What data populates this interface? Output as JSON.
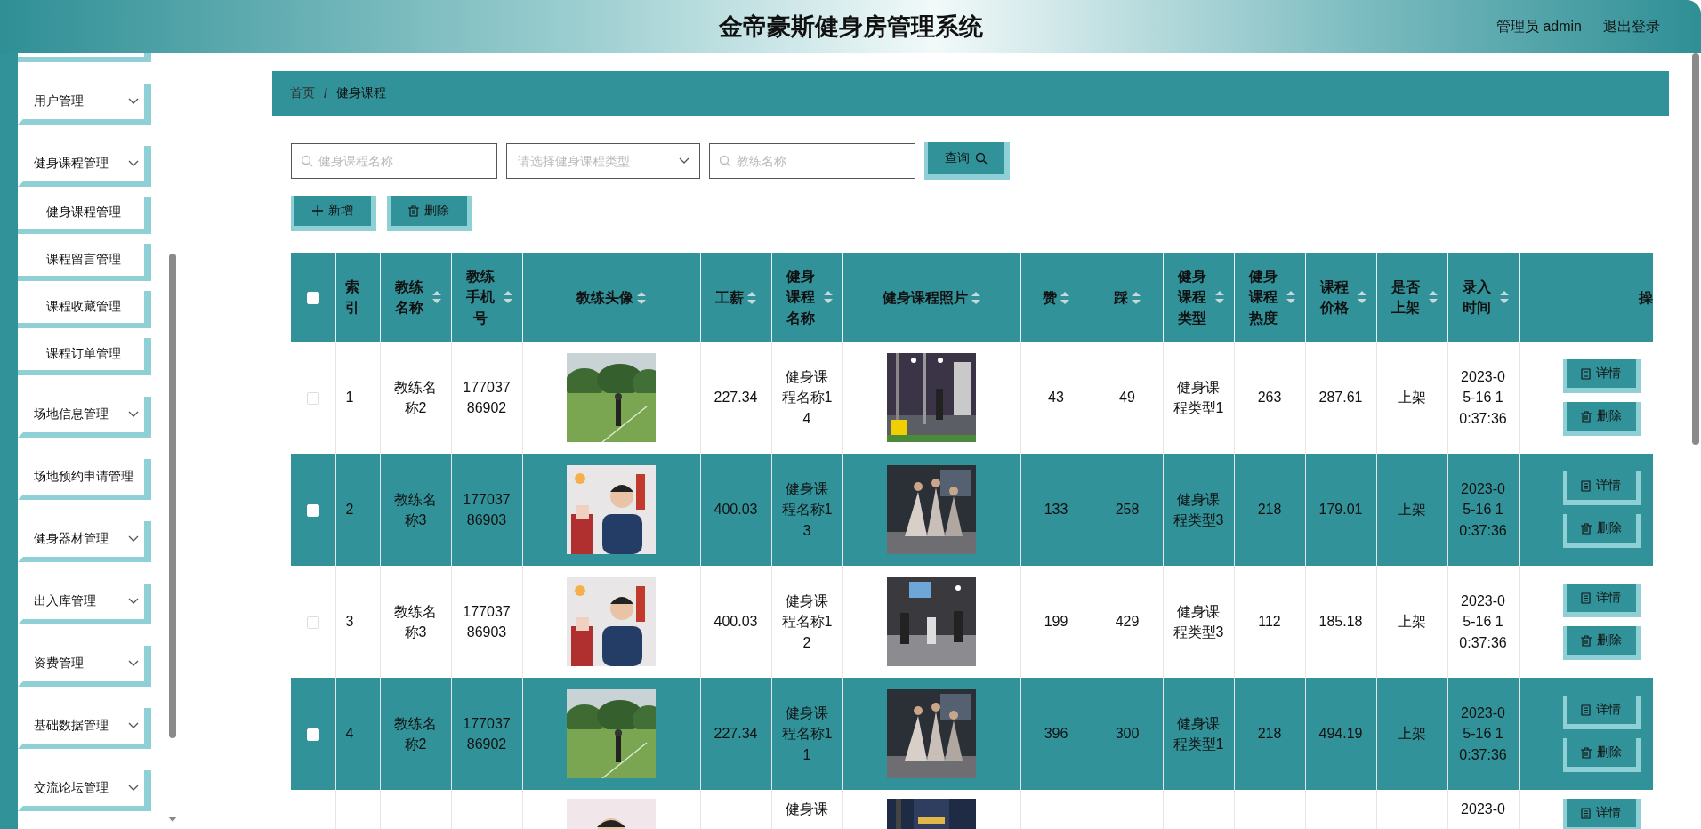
{
  "header": {
    "title": "金帝豪斯健身房管理系统",
    "user": "管理员 admin",
    "logout": "退出登录"
  },
  "sidebar": {
    "items": [
      {
        "label": "用户管理",
        "kind": "menu"
      },
      {
        "label": "健身课程管理",
        "kind": "menu",
        "children": [
          {
            "label": "健身课程管理"
          },
          {
            "label": "课程留言管理"
          },
          {
            "label": "课程收藏管理"
          },
          {
            "label": "课程订单管理"
          }
        ]
      },
      {
        "label": "场地信息管理",
        "kind": "menu"
      },
      {
        "label": "场地预约申请管理",
        "kind": "link"
      },
      {
        "label": "健身器材管理",
        "kind": "menu"
      },
      {
        "label": "出入库管理",
        "kind": "menu"
      },
      {
        "label": "资费管理",
        "kind": "menu"
      },
      {
        "label": "基础数据管理",
        "kind": "menu"
      },
      {
        "label": "交流论坛管理",
        "kind": "menu"
      }
    ]
  },
  "breadcrumb": {
    "items": [
      "首页",
      "健身课程"
    ],
    "separator": "/"
  },
  "filters": [
    {
      "kind": "search",
      "placeholder": "健身课程名称"
    },
    {
      "kind": "select",
      "placeholder": "请选择健身课程类型"
    },
    {
      "kind": "search",
      "placeholder": "教练名称"
    }
  ],
  "query_button": "查询",
  "actions": [
    {
      "kind": "add",
      "label": "新增"
    },
    {
      "kind": "delete",
      "label": "删除"
    }
  ],
  "table": {
    "select_all": {
      "checked": false
    },
    "columns": [
      {
        "label": "索引",
        "sortable": false
      },
      {
        "label": "教练名称",
        "sortable": true
      },
      {
        "label": "教练手机号",
        "sortable": true
      },
      {
        "label": "教练头像",
        "sortable": true
      },
      {
        "label": "工薪",
        "sortable": true
      },
      {
        "label": "健身课程名称",
        "sortable": true
      },
      {
        "label": "健身课程照片",
        "sortable": true
      },
      {
        "label": "赞",
        "sortable": true
      },
      {
        "label": "踩",
        "sortable": true
      },
      {
        "label": "健身课程类型",
        "sortable": true
      },
      {
        "label": "健身课程热度",
        "sortable": true
      },
      {
        "label": "课程价格",
        "sortable": true
      },
      {
        "label": "是否上架",
        "sortable": true
      },
      {
        "label": "录入时间",
        "sortable": true
      },
      {
        "label": "操",
        "sortable": false
      }
    ],
    "rows": [
      {
        "checked": false,
        "index": "1",
        "coach_name": "教练名称2",
        "phone": "17703786902",
        "salary": "227.34",
        "course_name": "健身课程名称14",
        "likes": "43",
        "dislikes": "49",
        "type": "健身课程类型1",
        "heat": "263",
        "price": "287.61",
        "status": "上架",
        "time": "2023-05-16 10:37:36",
        "actions": [
          "详情",
          "删除"
        ]
      },
      {
        "checked": false,
        "index": "2",
        "coach_name": "教练名称3",
        "phone": "17703786903",
        "salary": "400.03",
        "course_name": "健身课程名称13",
        "likes": "133",
        "dislikes": "258",
        "type": "健身课程类型3",
        "heat": "218",
        "price": "179.01",
        "status": "上架",
        "time": "2023-05-16 10:37:36",
        "actions": [
          "详情",
          "删除"
        ]
      },
      {
        "checked": false,
        "index": "3",
        "coach_name": "教练名称3",
        "phone": "17703786903",
        "salary": "400.03",
        "course_name": "健身课程名称12",
        "likes": "199",
        "dislikes": "429",
        "type": "健身课程类型3",
        "heat": "112",
        "price": "185.18",
        "status": "上架",
        "time": "2023-05-16 10:37:36",
        "actions": [
          "详情",
          "删除"
        ]
      },
      {
        "checked": false,
        "index": "4",
        "coach_name": "教练名称2",
        "phone": "17703786902",
        "salary": "227.34",
        "course_name": "健身课程名称11",
        "likes": "396",
        "dislikes": "300",
        "type": "健身课程类型1",
        "heat": "218",
        "price": "494.19",
        "status": "上架",
        "time": "2023-05-16 10:37:36",
        "actions": [
          "详情",
          "删除"
        ]
      },
      {
        "course_name": "健身课",
        "time": "2023-0",
        "actions": [
          "详情"
        ]
      }
    ]
  }
}
